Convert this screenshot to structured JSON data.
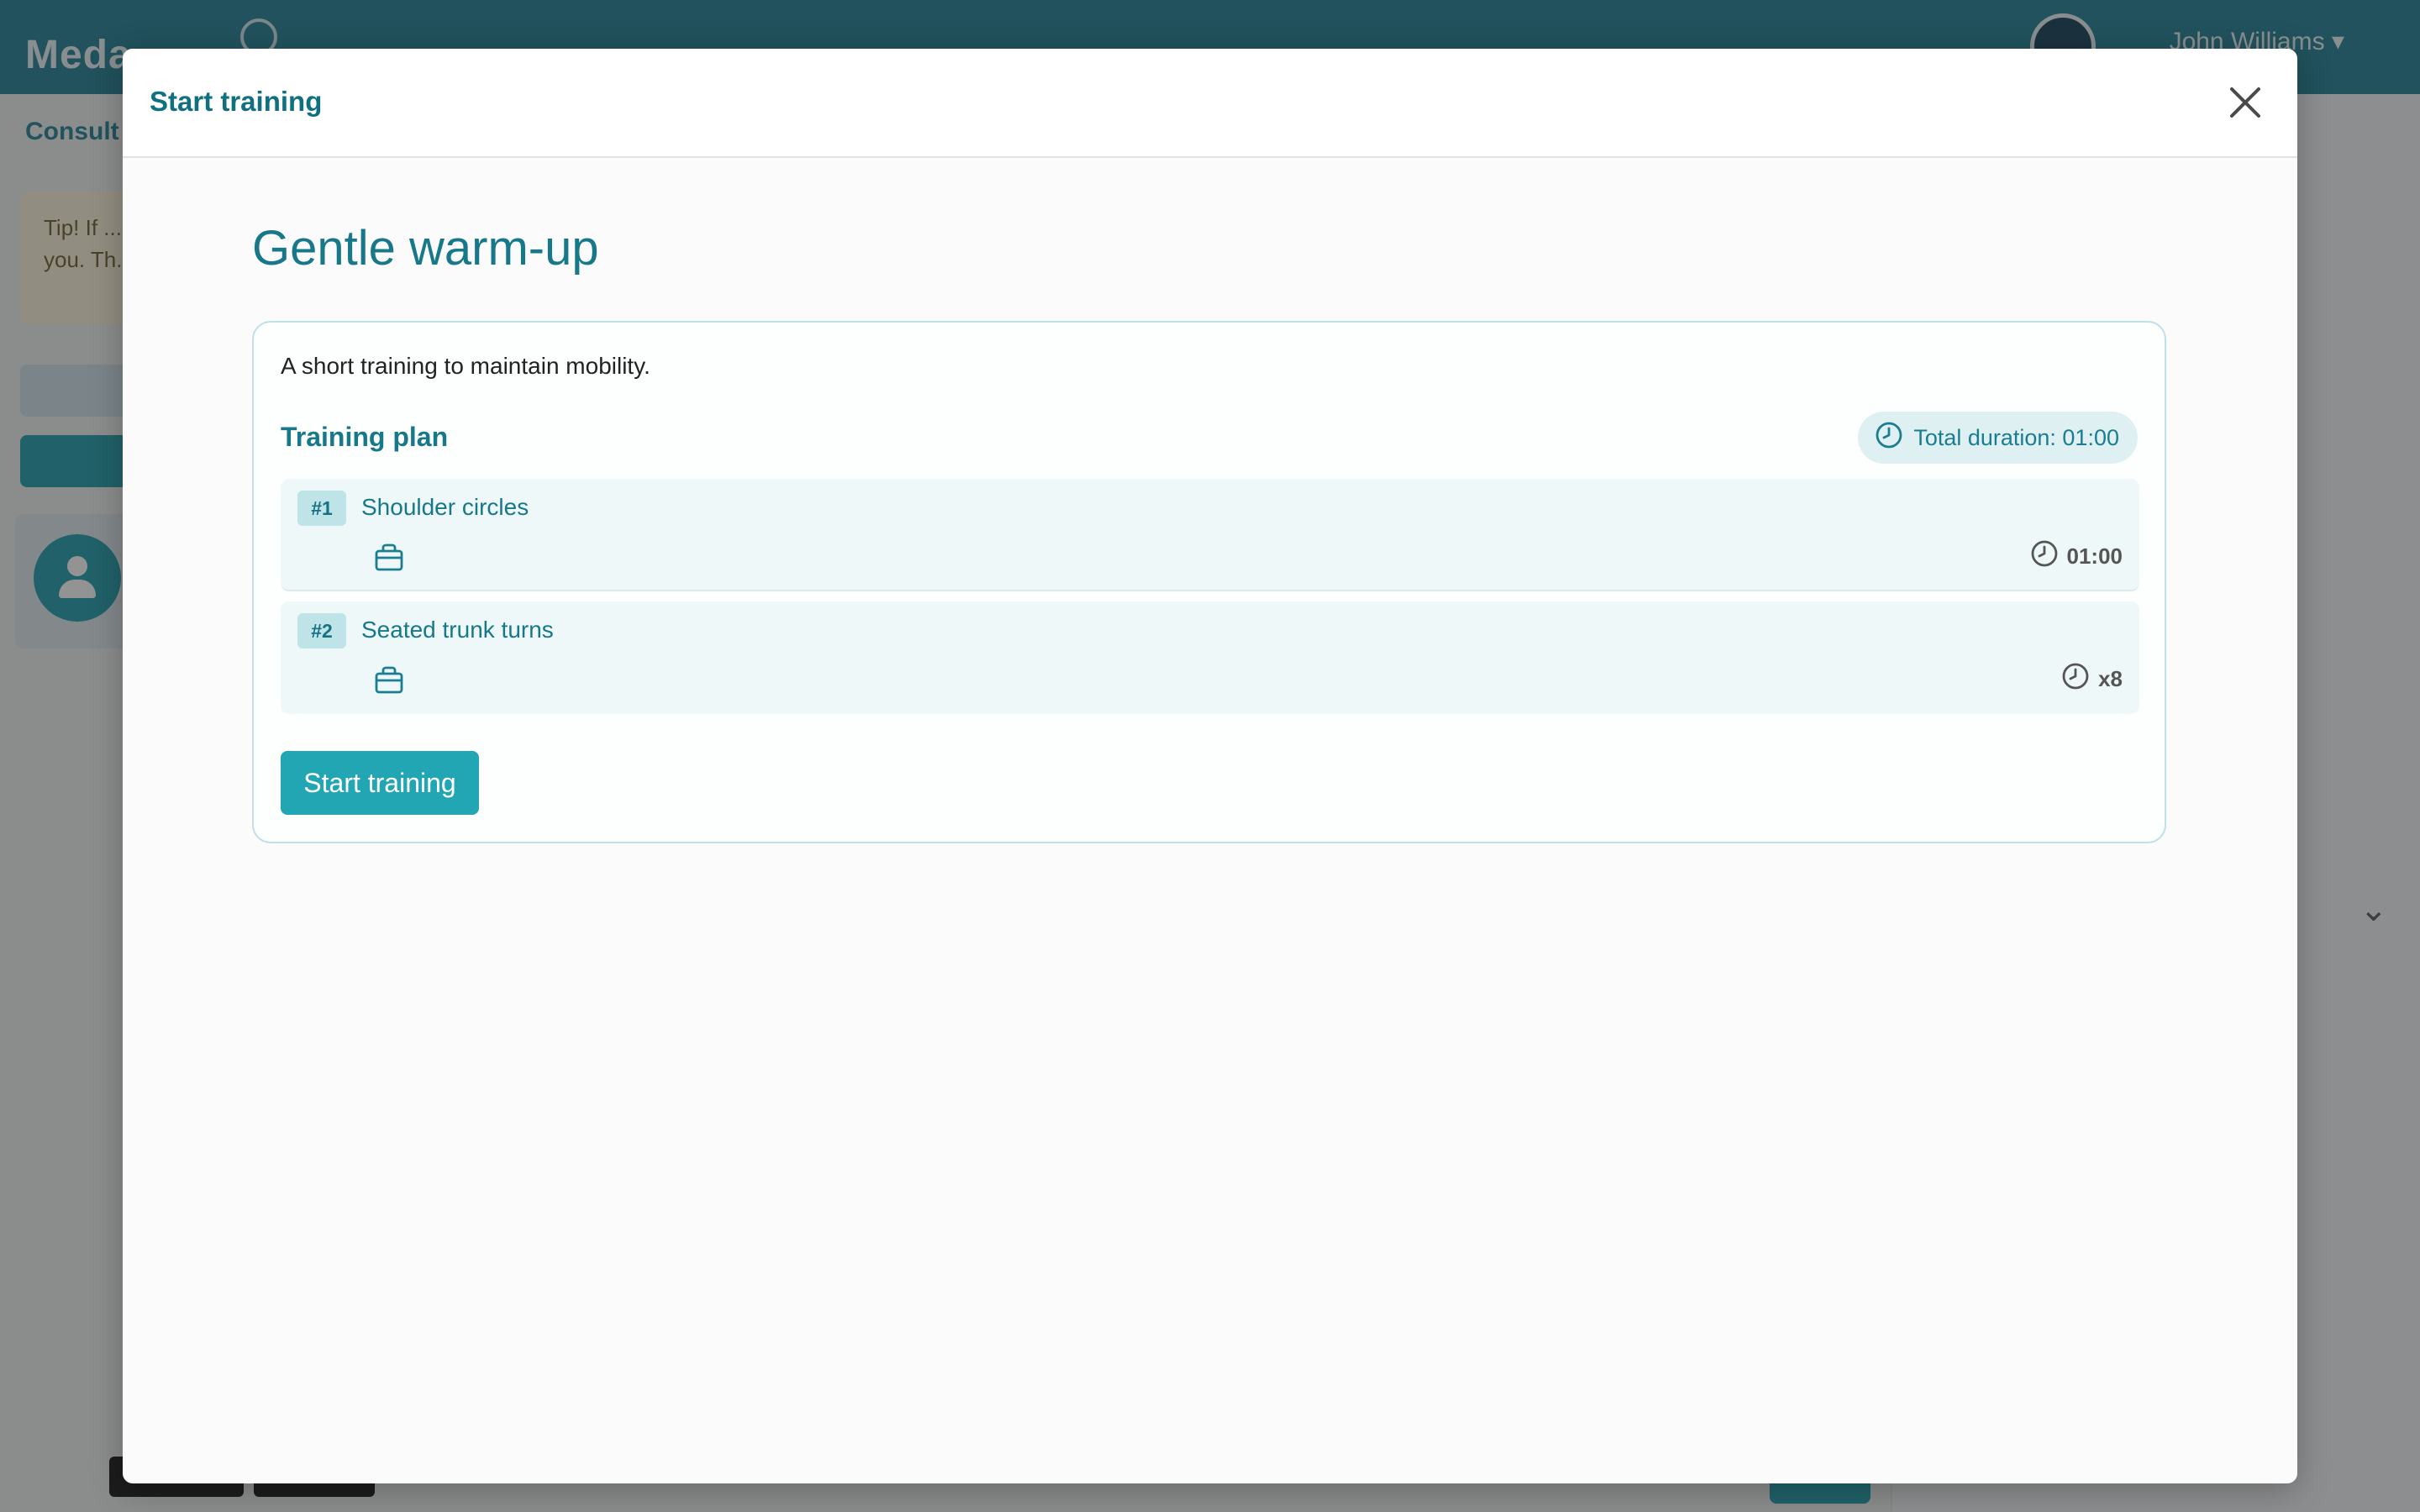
{
  "background": {
    "app_name": "Meda",
    "breadcrumb": "Consult",
    "tip_text": "Tip! If ... easier ... you. Th...",
    "user_name": "John Williams ▾"
  },
  "modal": {
    "title": "Start training",
    "close_icon": "close-x-icon"
  },
  "training": {
    "title": "Gentle warm-up",
    "description": "A short training to maintain mobility.",
    "plan_heading": "Training plan",
    "total_duration": "Total duration: 01:00",
    "exercises": [
      {
        "number": "#1",
        "name": "Shoulder circles",
        "equipment_icon": "bag-icon",
        "meta_icon": "clock-icon",
        "meta": "01:00"
      },
      {
        "number": "#2",
        "name": "Seated trunk turns",
        "equipment_icon": "bag-icon",
        "meta_icon": "clock-icon",
        "meta": "x8"
      }
    ],
    "start_button": "Start training"
  },
  "colors": {
    "header_bg": "#1a7d92",
    "accent": "#23a6b4",
    "title_text": "#17788a",
    "chip_bg": "#dff0f2",
    "row_bg": "#eef8f8"
  }
}
